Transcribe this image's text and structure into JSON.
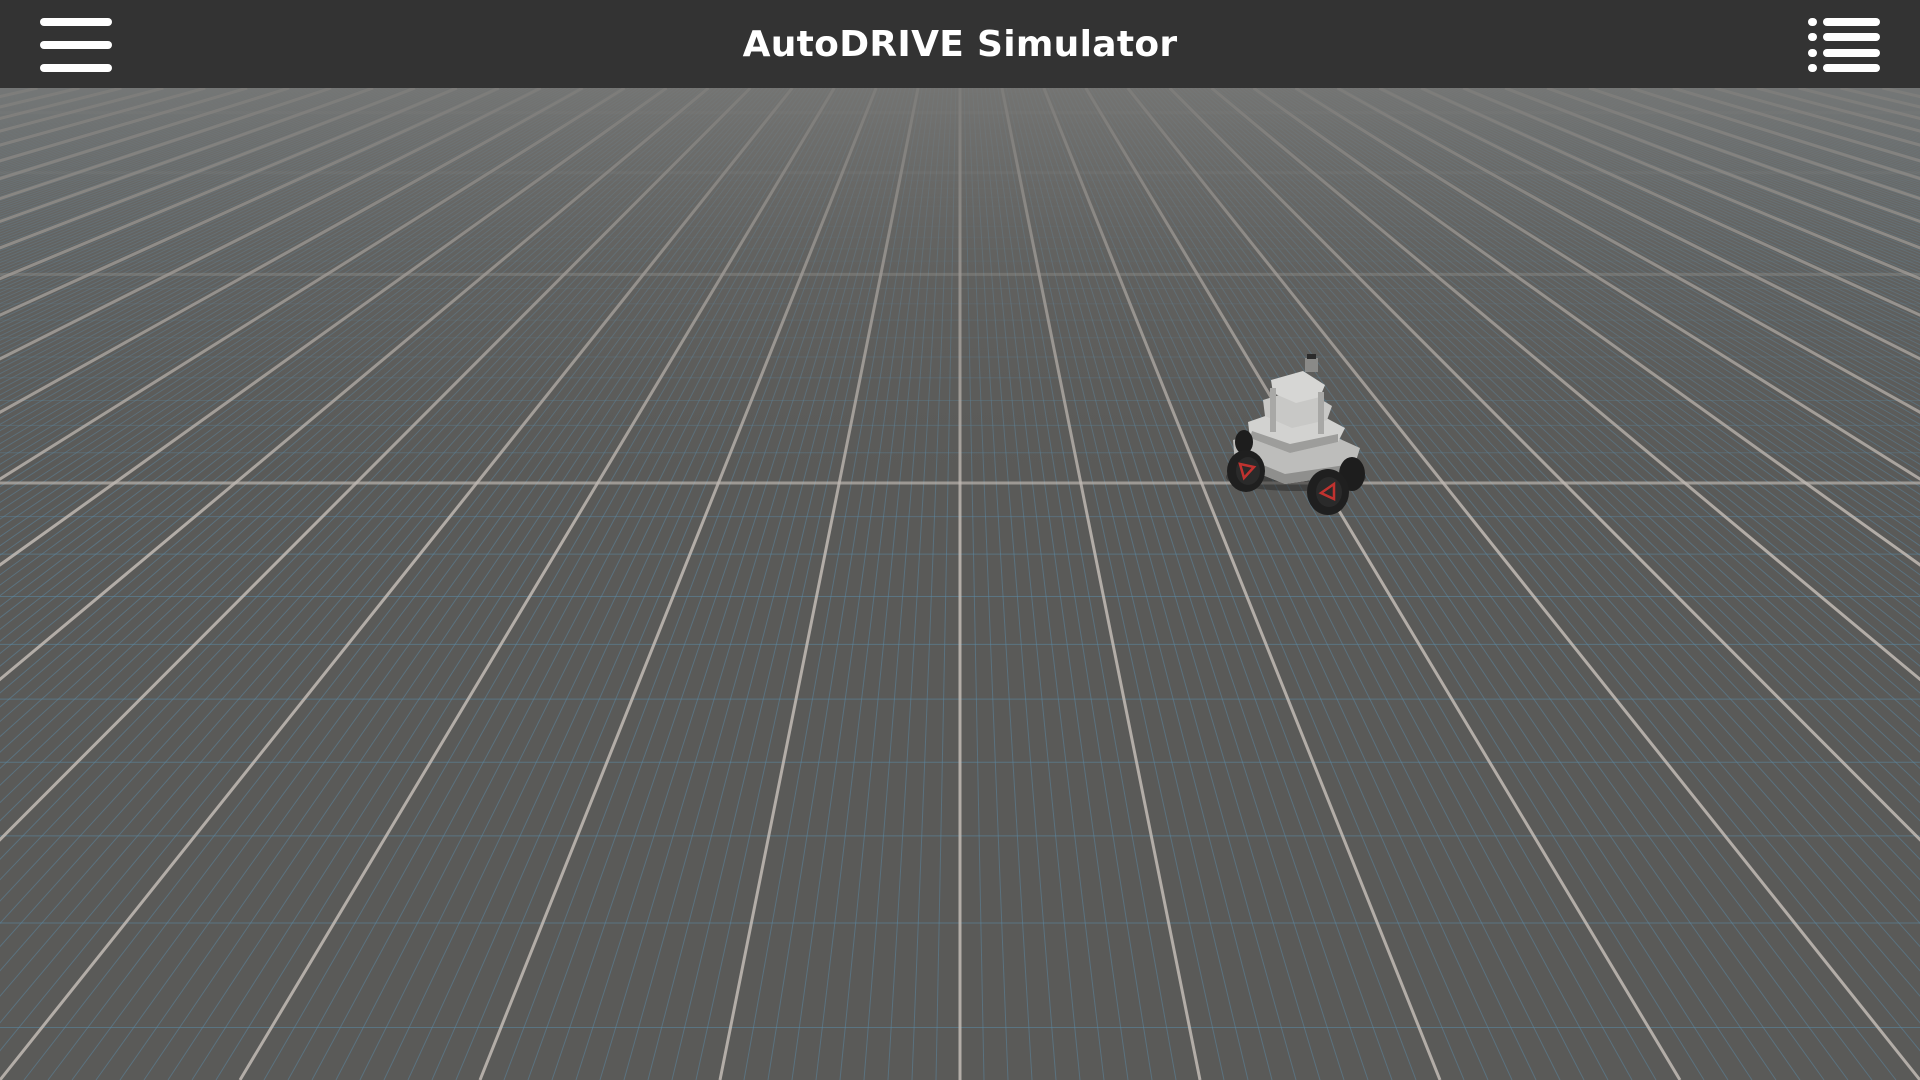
{
  "app": {
    "title": "AutoDRIVE Simulator"
  },
  "toolbar": {
    "left_button_icon": "hamburger-menu-icon",
    "right_button_icon": "list-menu-icon"
  },
  "scene": {
    "ground": "grid-floor",
    "vehicle": "roboracer-vehicle",
    "colors": {
      "topbar": "#333333",
      "floor": "#5a5a58",
      "major_grid": "#c9c2bb",
      "minor_grid": "#5b8aa6",
      "accent_red": "#c0322f"
    }
  }
}
